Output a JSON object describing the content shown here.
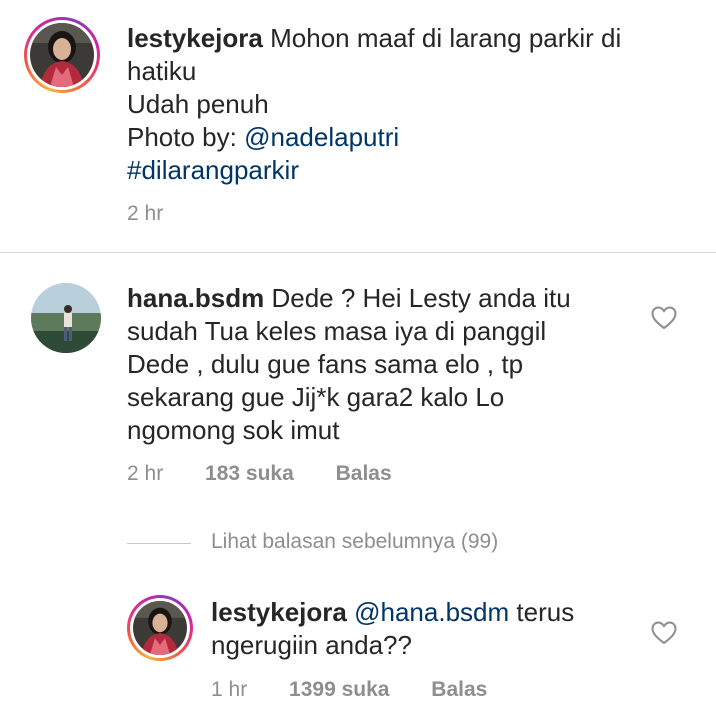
{
  "post": {
    "username": "lestykejora",
    "caption_line1": "Mohon maaf di larang parkir di",
    "caption_line2": "hatiku",
    "caption_line3": "Udah penuh",
    "photo_by": "Photo by:",
    "photo_by_mention": "@nadelaputri",
    "hashtag": "#dilarangparkir",
    "time": "2 hr"
  },
  "comment": {
    "username": "hana.bsdm",
    "lines": [
      "Dede ? Hei Lesty anda itu",
      "sudah Tua keles masa iya di panggil",
      "Dede , dulu gue fans sama elo , tp",
      "sekarang gue Jij*k gara2 kalo Lo",
      "ngomong sok imut"
    ],
    "time": "2 hr",
    "likes": "183 suka",
    "reply_label": "Balas"
  },
  "view_previous_replies": "Lihat balasan sebelumnya (99)",
  "reply": {
    "username": "lestykejora",
    "mention": "@hana.bsdm",
    "text_after_mention": "terus",
    "line2": "ngerugiin anda??",
    "time": "1 hr",
    "likes": "1399 suka",
    "reply_label": "Balas"
  },
  "icons": {
    "like": "heart-outline-icon"
  },
  "colors": {
    "link": "#003569",
    "meta": "#8e8e8e",
    "divider": "#dbdbdb"
  }
}
